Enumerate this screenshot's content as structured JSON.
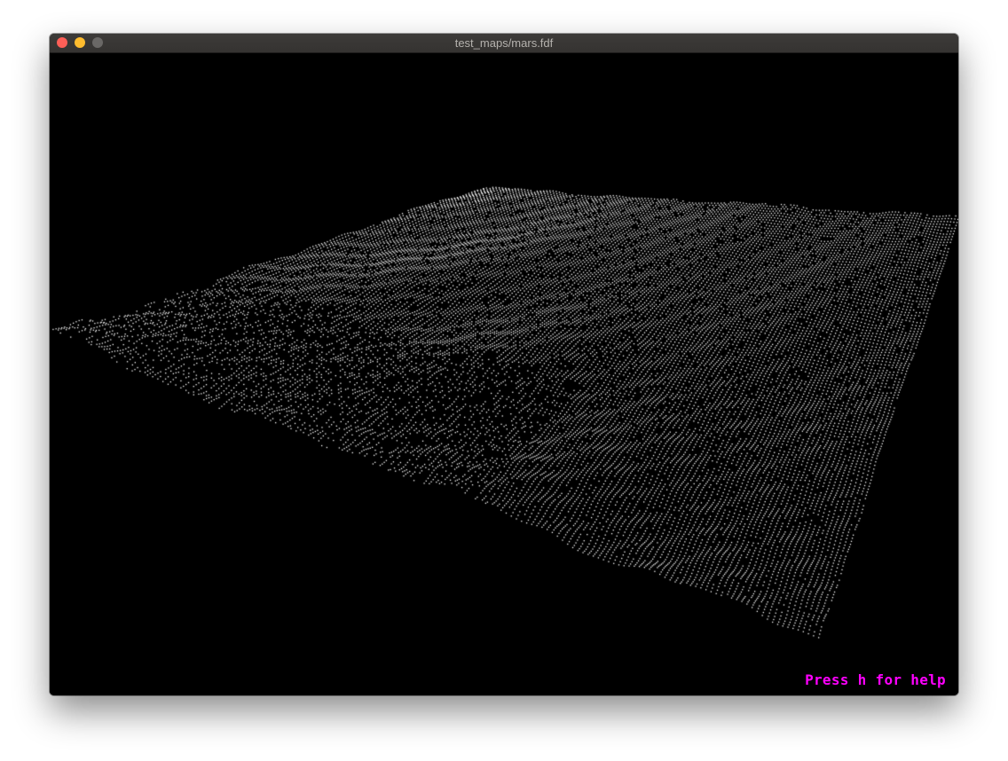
{
  "window": {
    "title": "test_maps/mars.fdf",
    "controls": {
      "close_color": "#fe5f57",
      "minimize_color": "#febc2e",
      "zoom_color": "#6a6866"
    }
  },
  "viewport": {
    "background_color": "#000000",
    "point_color": "#ffffff",
    "map_name": "mars"
  },
  "overlay": {
    "help_text": "Press h for help",
    "help_color": "#ff00ff"
  }
}
